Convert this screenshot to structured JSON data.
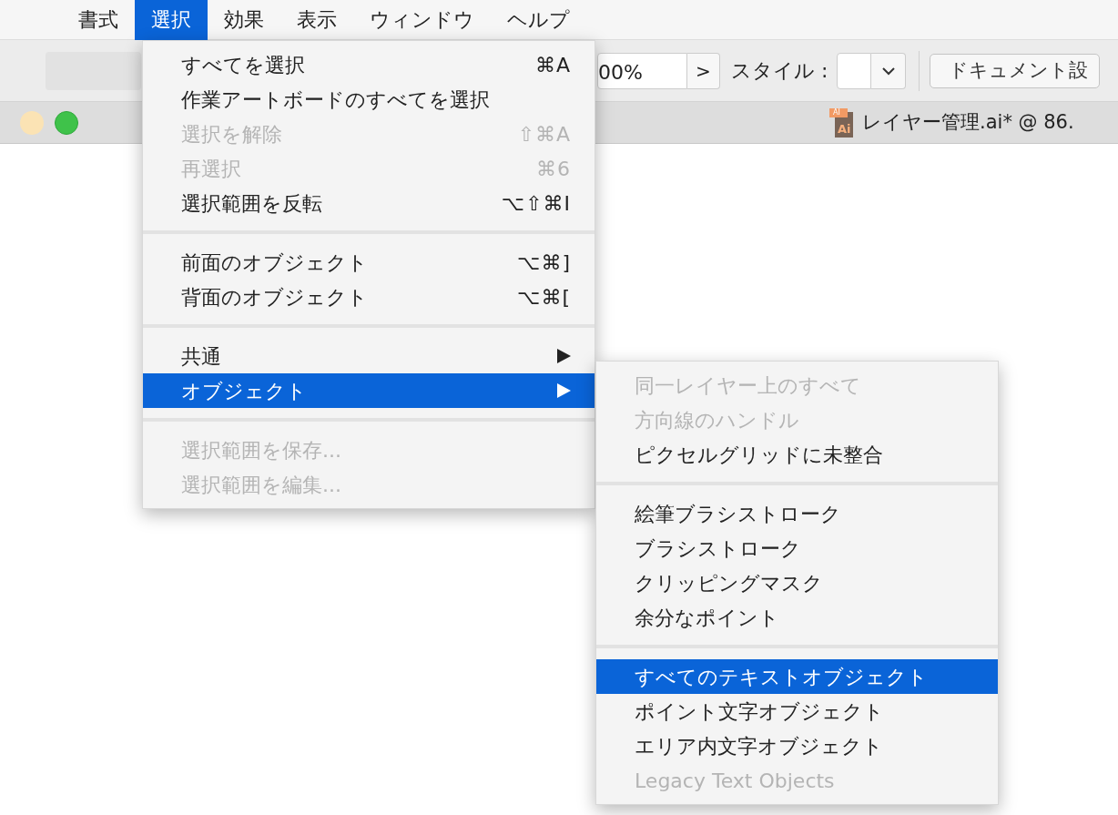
{
  "menubar": [
    {
      "label": "書式",
      "selected": false
    },
    {
      "label": "選択",
      "selected": true
    },
    {
      "label": "効果",
      "selected": false
    },
    {
      "label": "表示",
      "selected": false
    },
    {
      "label": "ウィンドウ",
      "selected": false
    },
    {
      "label": "ヘルプ",
      "selected": false
    }
  ],
  "toolbar": {
    "zoom_value": "00%",
    "next_label": ">",
    "style_label": "スタイル :",
    "document_settings_button": "ドキュメント設"
  },
  "document_tab": {
    "title": "レイヤー管理.ai* @ 86.",
    "file_badge_top": "AI",
    "file_badge": "Ai"
  },
  "menu": [
    {
      "kind": "item",
      "label": "すべてを選択",
      "shortcut": "⌘A",
      "disabled": false,
      "selected": false,
      "submenu": false
    },
    {
      "kind": "item",
      "label": "作業アートボードのすべてを選択",
      "disabled": false,
      "selected": false,
      "submenu": false
    },
    {
      "kind": "item",
      "label": "選択を解除",
      "shortcut": "⇧⌘A",
      "disabled": true,
      "selected": false,
      "submenu": false
    },
    {
      "kind": "item",
      "label": "再選択",
      "shortcut": "⌘6",
      "disabled": true,
      "selected": false,
      "submenu": false
    },
    {
      "kind": "item",
      "label": "選択範囲を反転",
      "shortcut": "⌥⇧⌘I",
      "disabled": false,
      "selected": false,
      "submenu": false
    },
    {
      "kind": "separator"
    },
    {
      "kind": "item",
      "label": "前面のオブジェクト",
      "shortcut": "⌥⌘]",
      "disabled": false,
      "selected": false,
      "submenu": false
    },
    {
      "kind": "item",
      "label": "背面のオブジェクト",
      "shortcut": "⌥⌘[",
      "disabled": false,
      "selected": false,
      "submenu": false
    },
    {
      "kind": "separator"
    },
    {
      "kind": "item",
      "label": "共通",
      "disabled": false,
      "selected": false,
      "submenu": true
    },
    {
      "kind": "item",
      "label": "オブジェクト",
      "disabled": false,
      "selected": true,
      "submenu": true
    },
    {
      "kind": "separator"
    },
    {
      "kind": "item",
      "label": "選択範囲を保存...",
      "disabled": true,
      "selected": false,
      "submenu": false
    },
    {
      "kind": "item",
      "label": "選択範囲を編集...",
      "disabled": true,
      "selected": false,
      "submenu": false
    }
  ],
  "submenu": [
    {
      "kind": "item",
      "label": "同一レイヤー上のすべて",
      "disabled": true,
      "selected": false
    },
    {
      "kind": "item",
      "label": "方向線のハンドル",
      "disabled": true,
      "selected": false
    },
    {
      "kind": "item",
      "label": "ピクセルグリッドに未整合",
      "disabled": false,
      "selected": false
    },
    {
      "kind": "separator"
    },
    {
      "kind": "item",
      "label": "絵筆ブラシストローク",
      "disabled": false,
      "selected": false
    },
    {
      "kind": "item",
      "label": "ブラシストローク",
      "disabled": false,
      "selected": false
    },
    {
      "kind": "item",
      "label": "クリッピングマスク",
      "disabled": false,
      "selected": false
    },
    {
      "kind": "item",
      "label": "余分なポイント",
      "disabled": false,
      "selected": false
    },
    {
      "kind": "separator"
    },
    {
      "kind": "item",
      "label": "すべてのテキストオブジェクト",
      "disabled": false,
      "selected": true
    },
    {
      "kind": "item",
      "label": "ポイント文字オブジェクト",
      "disabled": false,
      "selected": false
    },
    {
      "kind": "item",
      "label": "エリア内文字オブジェクト",
      "disabled": false,
      "selected": false
    },
    {
      "kind": "item",
      "label": "Legacy Text Objects",
      "disabled": true,
      "selected": false
    }
  ]
}
